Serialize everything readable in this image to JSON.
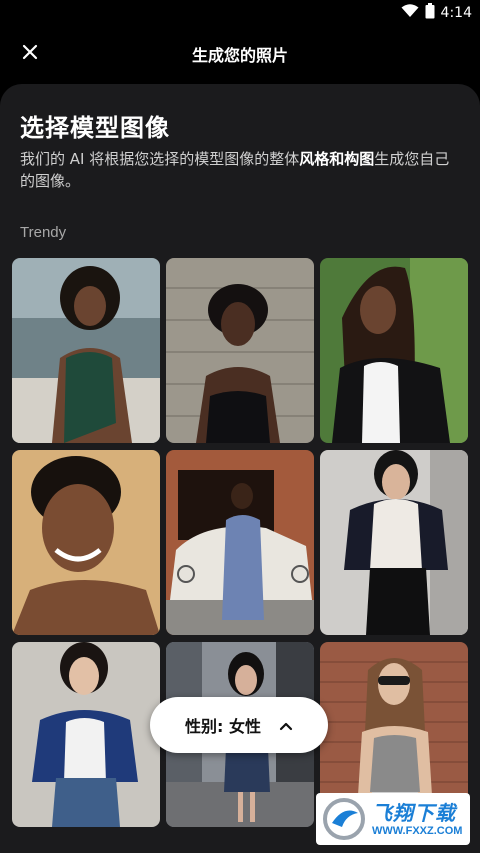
{
  "status_bar": {
    "time": "4:14",
    "wifi_icon": "wifi-icon",
    "battery_icon": "battery-icon"
  },
  "header": {
    "title": "生成您的照片",
    "close_icon": "close-icon"
  },
  "content": {
    "heading": "选择模型图像",
    "description_prefix": "我们的 AI 将根据您选择的模型图像的整体",
    "description_bold": "风格和构图",
    "description_suffix": "生成您自己的图像。",
    "section_label": "Trendy"
  },
  "tiles": [
    {
      "name": "model-photo-1"
    },
    {
      "name": "model-photo-2"
    },
    {
      "name": "model-photo-3"
    },
    {
      "name": "model-photo-4"
    },
    {
      "name": "model-photo-5"
    },
    {
      "name": "model-photo-6"
    },
    {
      "name": "model-photo-7"
    },
    {
      "name": "model-photo-8"
    },
    {
      "name": "model-photo-9"
    }
  ],
  "gender_button": {
    "label": "性别: 女性",
    "icon": "chevron-up-icon"
  },
  "watermark": {
    "main": "飞翔下载",
    "sub": "WWW.FXXZ.COM"
  }
}
